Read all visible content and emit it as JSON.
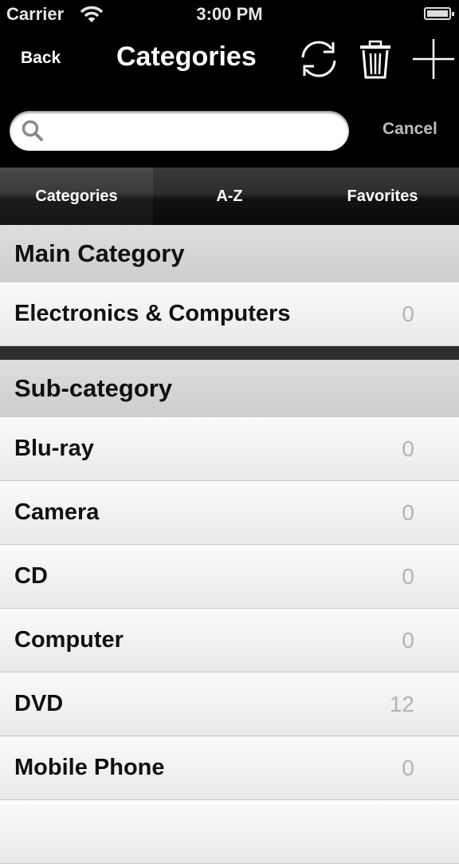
{
  "status_bar": {
    "carrier": "Carrier",
    "time": "3:00 PM"
  },
  "nav": {
    "back_label": "Back",
    "title": "Categories",
    "icons": [
      "refresh-icon",
      "trash-icon",
      "plus-icon"
    ]
  },
  "search": {
    "placeholder": "",
    "value": "",
    "cancel_label": "Cancel"
  },
  "tabs": [
    {
      "label": "Categories",
      "active": true
    },
    {
      "label": "A-Z",
      "active": false
    },
    {
      "label": "Favorites",
      "active": false
    }
  ],
  "sections": [
    {
      "header": "Main Category",
      "rows": [
        {
          "label": "Electronics & Computers",
          "count": "0"
        }
      ]
    },
    {
      "header": "Sub-category",
      "rows": [
        {
          "label": "Blu-ray",
          "count": "0"
        },
        {
          "label": "Camera",
          "count": "0"
        },
        {
          "label": "CD",
          "count": "0"
        },
        {
          "label": "Computer",
          "count": "0"
        },
        {
          "label": "DVD",
          "count": "12"
        },
        {
          "label": "Mobile Phone",
          "count": "0"
        }
      ]
    }
  ]
}
